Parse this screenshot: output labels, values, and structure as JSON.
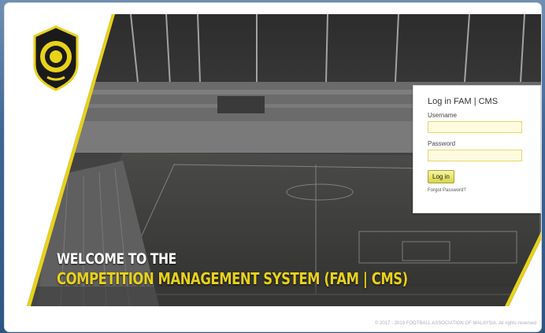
{
  "welcome": {
    "line1": "WELCOME TO THE",
    "line2": "COMPETITION MANAGEMENT SYSTEM (FAM | CMS)"
  },
  "login": {
    "title": "Log in FAM | CMS",
    "username_label": "Username",
    "username_value": "",
    "password_label": "Password",
    "password_value": "",
    "login_button": "Log in",
    "forgot_link": "Forgot Password?"
  },
  "footer": {
    "copyright": "© 2017 - 2019 FOOTBALL ASSOCIATION OF MALAYSIA. All rights reserved"
  },
  "colors": {
    "accent_yellow": "#e8d21a",
    "page_blue": "#3e6795"
  },
  "icons": {
    "logo": "fam-crest-logo"
  }
}
